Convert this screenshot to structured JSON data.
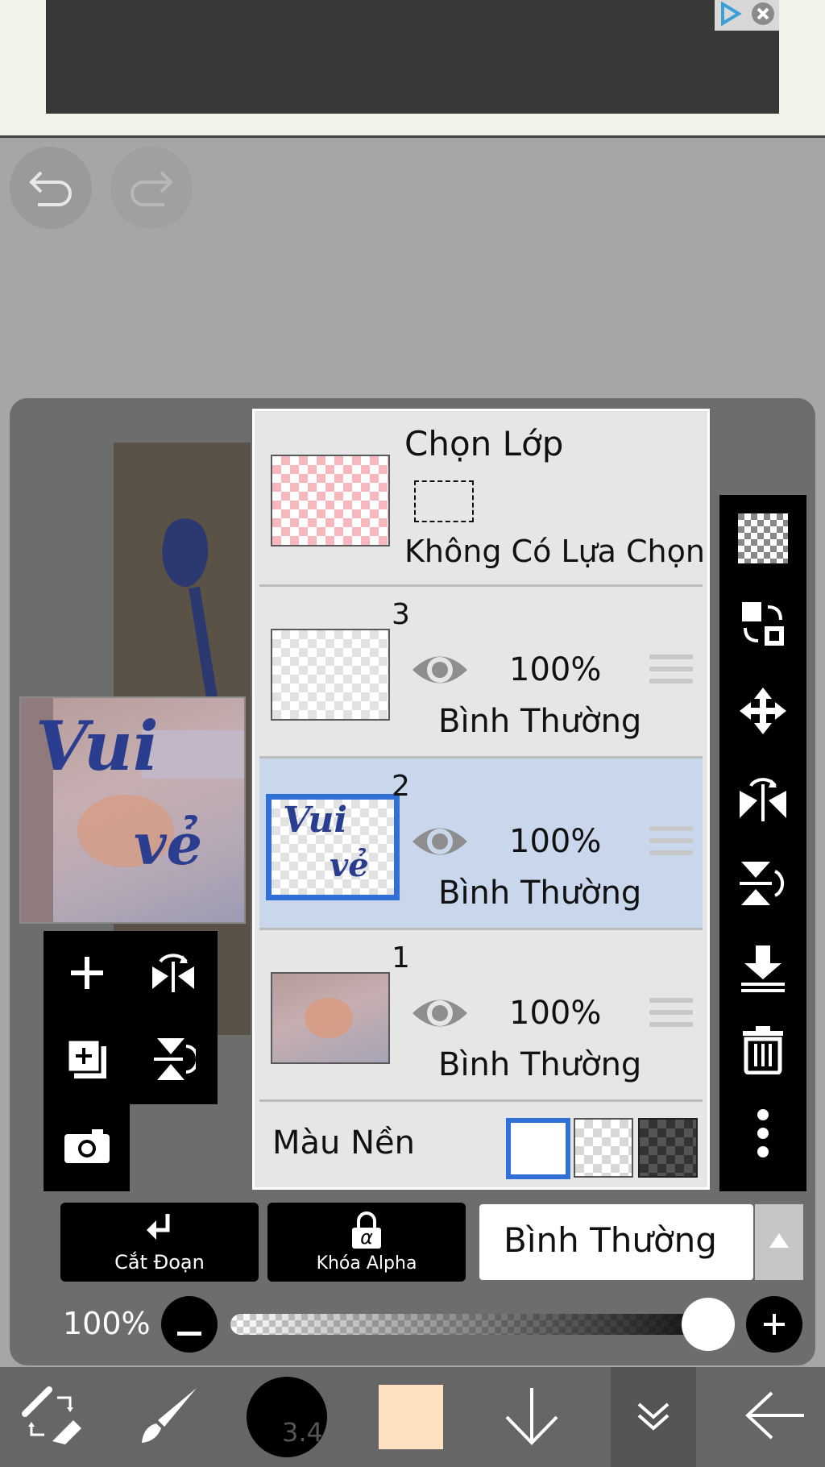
{
  "ad": {
    "icons": [
      "adchoices-icon",
      "close-icon"
    ]
  },
  "history": {
    "undo_icon": "undo-icon",
    "redo_icon": "redo-icon"
  },
  "selection_layer": {
    "title": "Chọn Lớp",
    "status": "Không Có Lựa Chọn"
  },
  "layers": [
    {
      "number": "3",
      "opacity": "100%",
      "blend": "Bình Thường",
      "visible": true,
      "selected": false
    },
    {
      "number": "2",
      "opacity": "100%",
      "blend": "Bình Thường",
      "visible": true,
      "selected": true,
      "thumb_text_1": "Vui",
      "thumb_text_2": "vẻ"
    },
    {
      "number": "1",
      "opacity": "100%",
      "blend": "Bình Thường",
      "visible": true,
      "selected": false
    }
  ],
  "background": {
    "label": "Màu Nền",
    "options": [
      "white",
      "transparent",
      "dark"
    ],
    "selected": "white"
  },
  "preview": {
    "text_1": "Vui",
    "text_2": "vẻ"
  },
  "left_tools": [
    "add-layer-icon",
    "flip-horizontal-icon",
    "copy-layer-icon",
    "flip-vertical-icon",
    "camera-icon"
  ],
  "right_tools": [
    "transparency-icon",
    "layer-swap-icon",
    "move-icon",
    "flip-horizontal-icon",
    "flip-vertical-icon",
    "merge-down-icon",
    "delete-icon",
    "more-icon"
  ],
  "buttons": {
    "clip": "Cắt Đoạn",
    "alpha_lock": "Khóa Alpha",
    "alpha_symbol": "α",
    "blend_mode": "Bình Thường"
  },
  "opacity": {
    "label": "100%",
    "value": 1.0
  },
  "bottom_bar": {
    "brush_size": "3.4",
    "color": "#ffe1c2",
    "icons": [
      "swap-tool-icon",
      "brush-icon",
      "brush-size-icon",
      "color-swatch",
      "arrow-down-icon",
      "chevron-double-down-icon",
      "back-arrow-icon"
    ]
  },
  "colors": {
    "accent": "#2f6fd6",
    "selected_layer": "#c8d7ec",
    "primary_color": "#ffe1c2"
  }
}
